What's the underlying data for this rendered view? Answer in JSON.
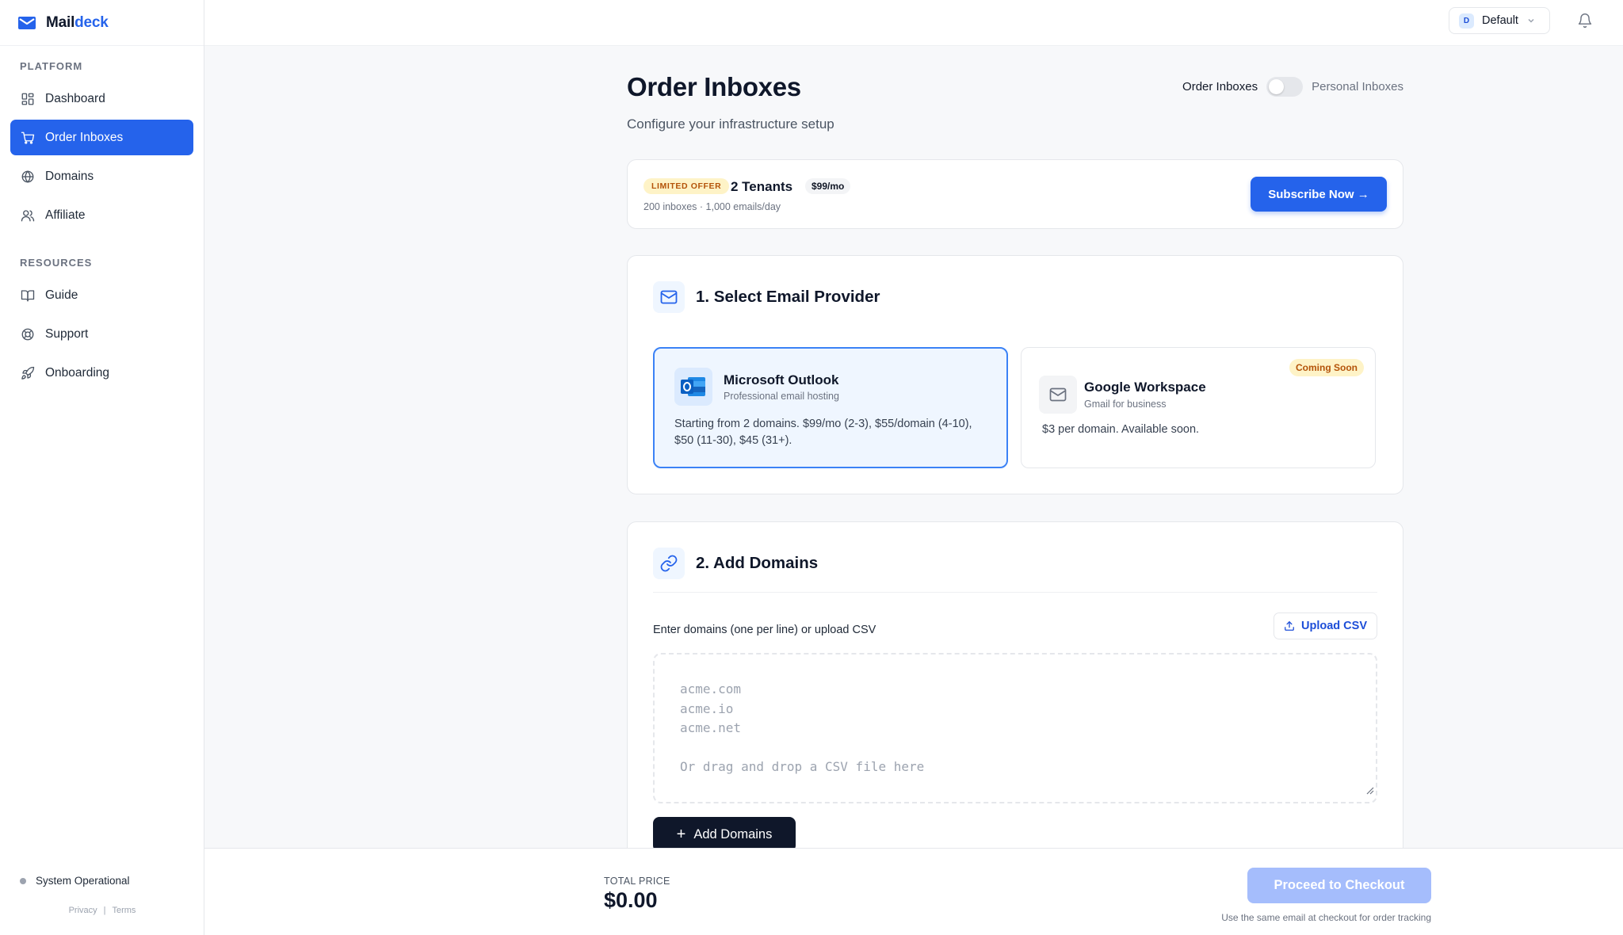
{
  "brand": {
    "name_part1": "Mail",
    "name_part2": "deck"
  },
  "sidebar": {
    "sections": [
      {
        "title": "PLATFORM"
      },
      {
        "title": "RESOURCES"
      }
    ],
    "platform_items": [
      {
        "label": "Dashboard",
        "icon": "dashboard-icon"
      },
      {
        "label": "Order Inboxes",
        "icon": "cart-icon",
        "active": true
      },
      {
        "label": "Domains",
        "icon": "globe-icon"
      },
      {
        "label": "Affiliate",
        "icon": "users-icon"
      }
    ],
    "resource_items": [
      {
        "label": "Guide",
        "icon": "book-icon"
      },
      {
        "label": "Support",
        "icon": "lifebuoy-icon"
      },
      {
        "label": "Onboarding",
        "icon": "rocket-icon"
      }
    ],
    "status": "System Operational",
    "footer_links": [
      "Privacy",
      "Terms"
    ]
  },
  "topbar": {
    "workspace": {
      "avatar": "D",
      "name": "Default"
    }
  },
  "page": {
    "title": "Order Inboxes",
    "subtitle": "Configure your infrastructure setup",
    "toggle": {
      "left_label": "Order Inboxes",
      "right_label": "Personal Inboxes",
      "on": false
    }
  },
  "offer": {
    "badge": "LIMITED OFFER",
    "title": "2 Tenants",
    "price": "$99/mo",
    "details": "200 inboxes · 1,000 emails/day",
    "button": "Subscribe Now →"
  },
  "provider_section": {
    "title": "1. Select Email Provider",
    "providers": [
      {
        "name": "Microsoft Outlook",
        "subtitle": "Professional email hosting",
        "description": "Starting from 2 domains. $99/mo (2-3), $55/domain (4-10), $50 (11-30), $45 (31+).",
        "selected": true
      },
      {
        "name": "Google Workspace",
        "subtitle": "Gmail for business",
        "description": "$3 per domain. Available soon.",
        "badge": "Coming Soon",
        "selected": false
      }
    ]
  },
  "domains_section": {
    "title": "2. Add Domains",
    "label": "Enter domains (one per line) or upload CSV",
    "upload_button": "Upload CSV",
    "placeholder": "acme.com\nacme.io\nacme.net\n\nOr drag and drop a CSV file here",
    "add_button": "Add Domains"
  },
  "checkout": {
    "total_label": "TOTAL PRICE",
    "total_value": "$0.00",
    "button": "Proceed to Checkout",
    "hint": "Use the same email at checkout for order tracking"
  },
  "colors": {
    "accent": "#2563eb",
    "sidebar_active_bg": "#2563eb",
    "badge_bg": "#fef3c7",
    "badge_text": "#b45309",
    "checkout_disabled": "#a5bdfc",
    "dark_button": "#0f172a"
  }
}
